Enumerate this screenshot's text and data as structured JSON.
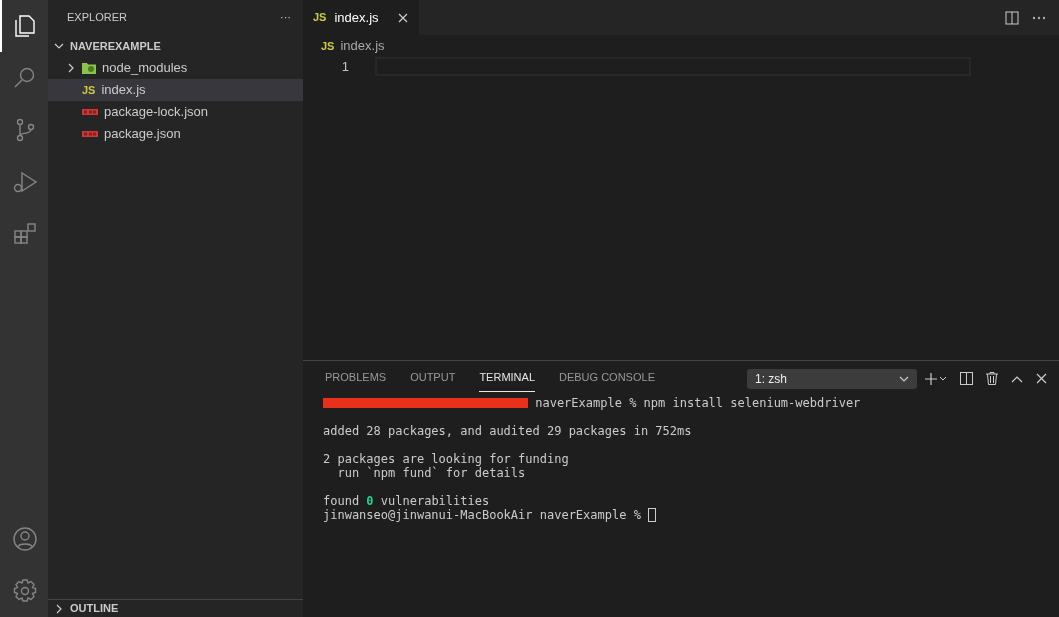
{
  "activity_bar": {
    "items": [
      {
        "selected": true
      },
      {
        "selected": false
      },
      {
        "selected": false
      },
      {
        "selected": false
      },
      {
        "selected": false
      }
    ]
  },
  "sidebar": {
    "title": "EXPLORER",
    "more": "···",
    "folder": "NAVEREXAMPLE",
    "items": [
      {
        "label": "node_modules",
        "kind": "folder",
        "selected": false
      },
      {
        "label": "index.js",
        "kind": "js",
        "badge": "JS",
        "selected": true
      },
      {
        "label": "package-lock.json",
        "kind": "npm",
        "selected": false
      },
      {
        "label": "package.json",
        "kind": "npm",
        "selected": false
      }
    ],
    "outline": "OUTLINE"
  },
  "tabs": [
    {
      "label": "index.js",
      "badge": "JS",
      "selected": true
    }
  ],
  "breadcrumb": {
    "badge": "JS",
    "label": "index.js"
  },
  "editor": {
    "lines": [
      "1"
    ]
  },
  "panel": {
    "tabs": [
      {
        "label": "PROBLEMS",
        "selected": false
      },
      {
        "label": "OUTPUT",
        "selected": false
      },
      {
        "label": "TERMINAL",
        "selected": true
      },
      {
        "label": "DEBUG CONSOLE",
        "selected": false
      }
    ],
    "terminal_select": "1: zsh",
    "blocks": [
      [
        {
          "redacted": true,
          "parts": [
            {
              "text": " naverExample % npm install selenium-webdriver",
              "highlight": false
            }
          ]
        }
      ],
      [
        {
          "parts": [
            {
              "text": "added 28 packages, and audited 29 packages in 752ms",
              "highlight": false
            }
          ]
        }
      ],
      [
        {
          "parts": [
            {
              "text": "2 packages are looking for funding",
              "highlight": false
            }
          ]
        },
        {
          "parts": [
            {
              "text": "  run `npm fund` for details",
              "highlight": false
            }
          ]
        }
      ],
      [
        {
          "parts": [
            {
              "text": "found ",
              "highlight": false
            },
            {
              "text": "0",
              "highlight": true
            },
            {
              "text": " vulnerabilities",
              "highlight": false
            }
          ]
        },
        {
          "cursor": true,
          "parts": [
            {
              "text": "jinwanseo@jinwanui-MacBookAir naverExample % ",
              "highlight": false
            }
          ]
        }
      ]
    ]
  }
}
